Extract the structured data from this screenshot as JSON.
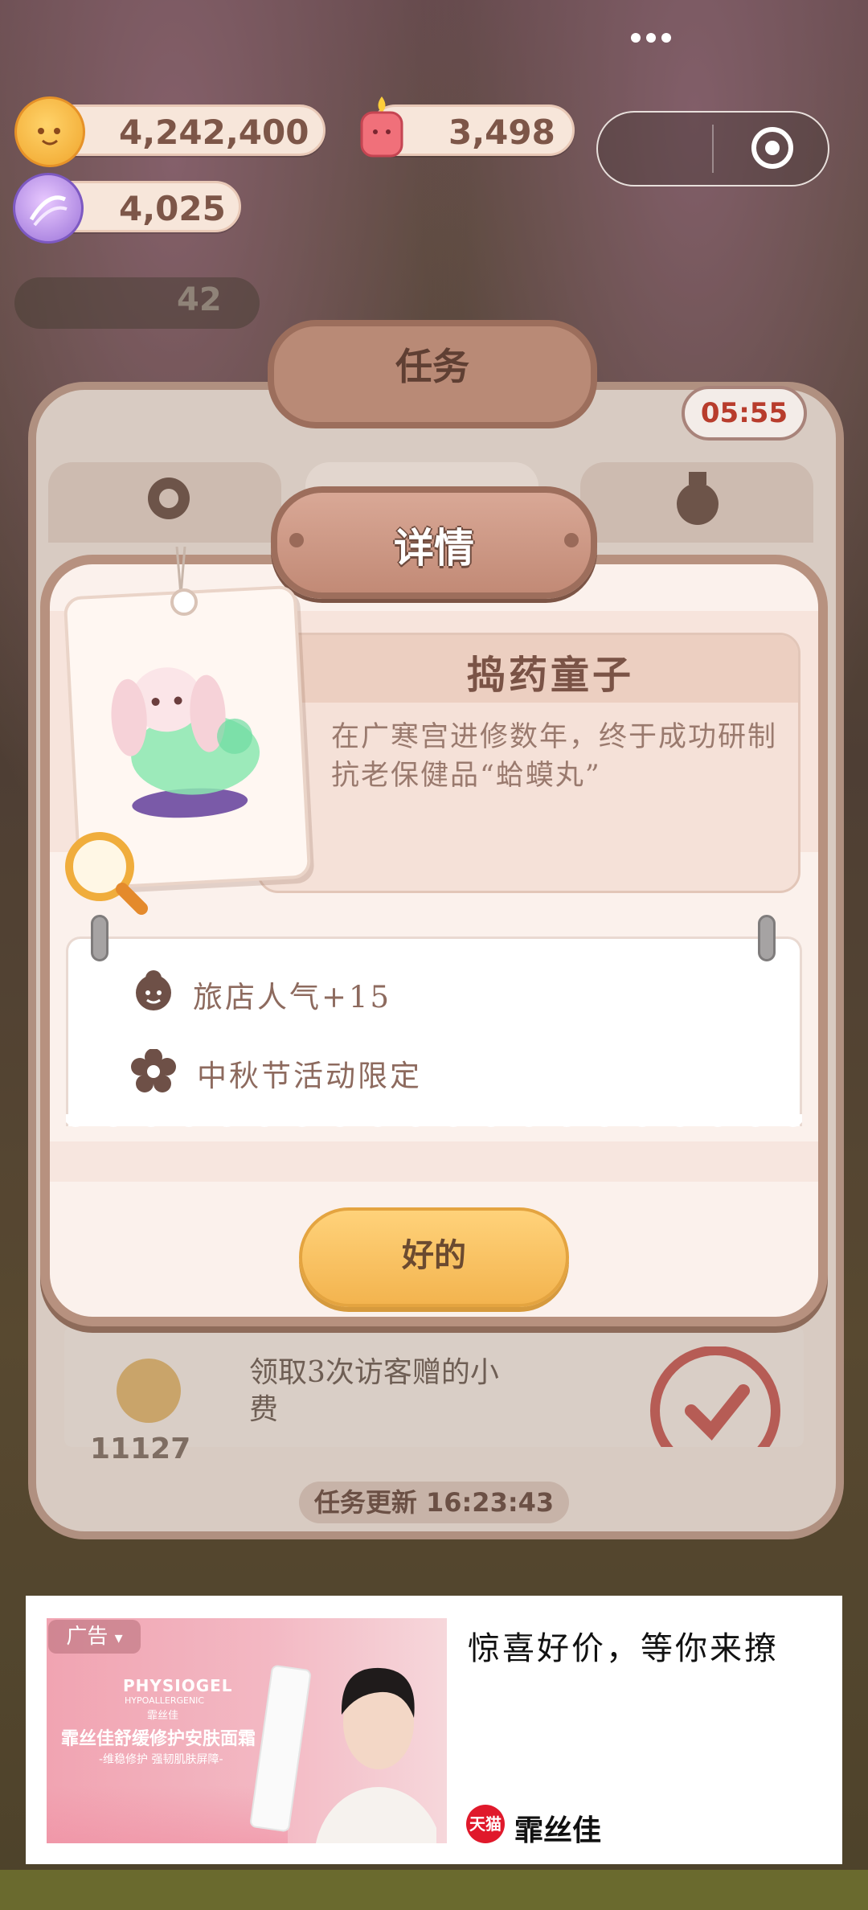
{
  "currencies": {
    "mooncake": "4,242,400",
    "candle": "3,498",
    "candy": "4,025",
    "bg_counter": "42"
  },
  "task_panel": {
    "title": "任务",
    "timer": "05:55",
    "refresh": "任务更新 16:23:43",
    "bg_row_text_1": "领取3次访客赠的小",
    "bg_row_text_2": "费",
    "bg_reward": "11127"
  },
  "dialog": {
    "title": "详情",
    "character_name": "捣药童子",
    "description": "在广寒宫进修数年，终于成功研制抗老保健品“蛤蟆丸”",
    "attributes": [
      {
        "icon": "inn-popularity-icon",
        "text": "旅店人气+15"
      },
      {
        "icon": "flower-icon",
        "text": "中秋节活动限定"
      }
    ],
    "ok_label": "好的"
  },
  "ad": {
    "label": "广告",
    "headline": "惊喜好价，等你来撩",
    "brand_logo": "天猫",
    "brand": "霏丝佳",
    "image_brand": "PHYSIOGEL",
    "image_brand_sub": "HYPOALLERGENIC",
    "image_brand_cn": "霏丝佳",
    "image_product": "霏丝佳舒缓修护安肤面霜",
    "image_tagline": "-维稳修护 强韧肌肤屏障-"
  },
  "colors": {
    "accent_brown": "#b7917f",
    "button_yellow": "#f3b44f",
    "timer_red": "#b83c2c",
    "ad_pink": "#f1a4b2"
  }
}
